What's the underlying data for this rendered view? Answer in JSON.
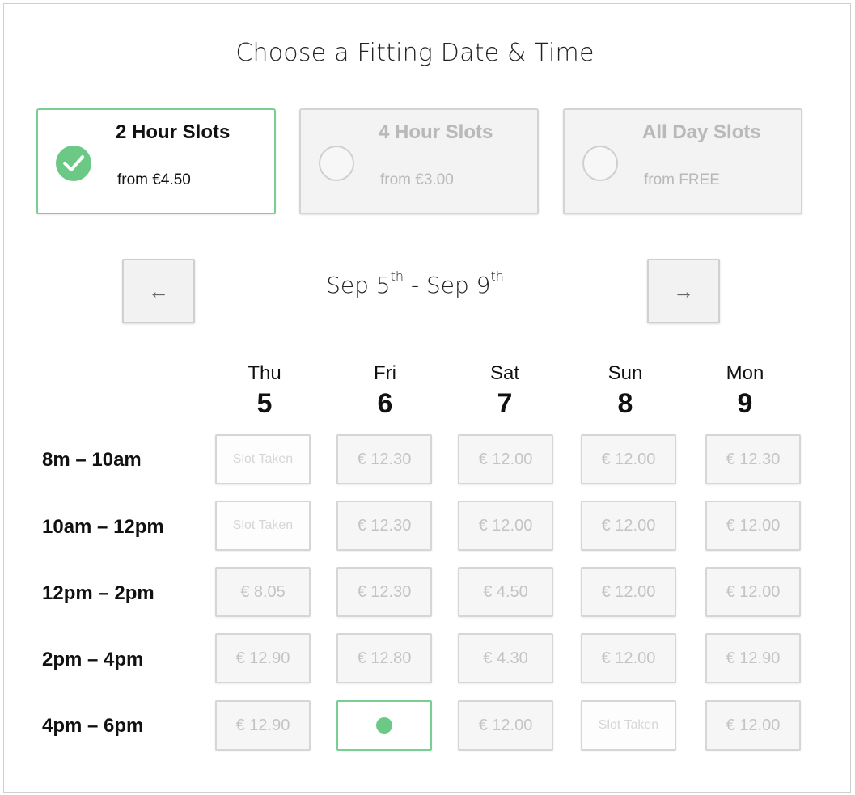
{
  "title": "Choose a Fitting Date & Time",
  "options": [
    {
      "name": "2 Hour Slots",
      "price": "from €4.50",
      "state": "selected"
    },
    {
      "name": "4 Hour Slots",
      "price": "from €3.00",
      "state": "disabled"
    },
    {
      "name": "All Day Slots",
      "price": "from FREE",
      "state": "disabled"
    }
  ],
  "nav": {
    "prev_label": "←",
    "next_label": "→",
    "range_start_prefix": "Sep 5",
    "range_start_suffix": "th",
    "range_sep": " - ",
    "range_end_prefix": "Sep 9",
    "range_end_suffix": "th"
  },
  "days": [
    {
      "name": "Thu",
      "num": "5"
    },
    {
      "name": "Fri",
      "num": "6"
    },
    {
      "name": "Sat",
      "num": "7"
    },
    {
      "name": "Sun",
      "num": "8"
    },
    {
      "name": "Mon",
      "num": "9"
    }
  ],
  "rows": [
    {
      "label": "8m – 10am",
      "slots": [
        "Slot Taken",
        "€ 12.30",
        "€ 12.00",
        "€ 12.00",
        "€ 12.30"
      ]
    },
    {
      "label": "10am – 12pm",
      "slots": [
        "Slot Taken",
        "€ 12.30",
        "€ 12.00",
        "€ 12.00",
        "€ 12.00"
      ]
    },
    {
      "label": "12pm – 2pm",
      "slots": [
        "€ 8.05",
        "€ 12.30",
        "€ 4.50",
        "€ 12.00",
        "€ 12.00"
      ]
    },
    {
      "label": "2pm – 4pm",
      "slots": [
        "€ 12.90",
        "€ 12.80",
        "€ 4.30",
        "€ 12.00",
        "€ 12.90"
      ]
    },
    {
      "label": "4pm – 6pm",
      "slots": [
        "€ 12.90",
        "",
        "€ 12.00",
        "Slot Taken",
        "€ 12.00"
      ]
    }
  ],
  "selected_slot": {
    "row": 4,
    "col": 1
  },
  "colors": {
    "accent": "#6cc985",
    "accent_border": "#78cf91",
    "disabled_text": "#b9b9b9"
  }
}
